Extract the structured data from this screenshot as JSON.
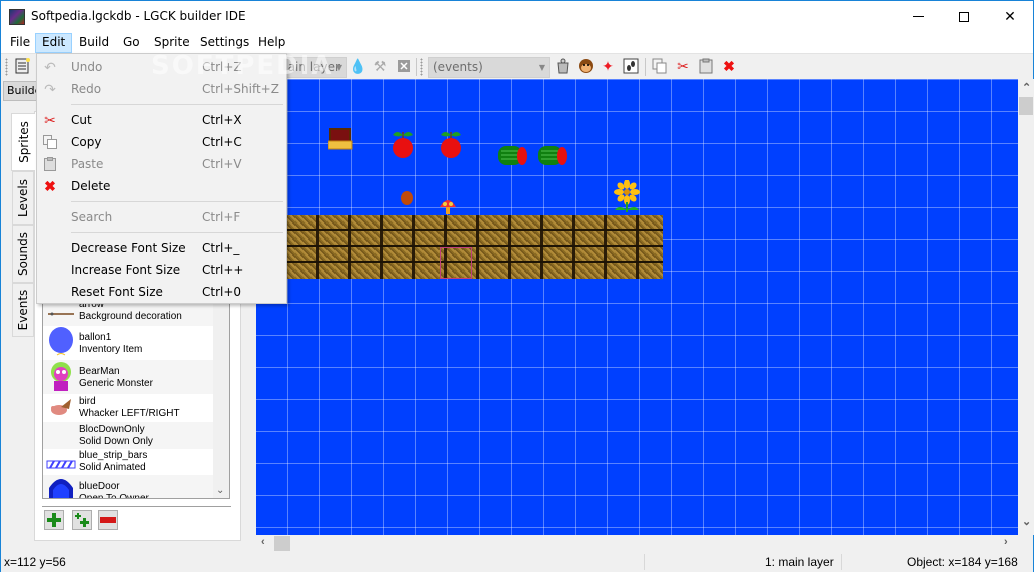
{
  "window": {
    "title": "Softpedia.lgckdb - LGCK builder IDE",
    "controls": {
      "minimize": "minimize",
      "maximize": "maximize",
      "close": "close"
    }
  },
  "menubar": {
    "items": [
      {
        "label": "File"
      },
      {
        "label": "Edit",
        "active": true
      },
      {
        "label": "Build"
      },
      {
        "label": "Go"
      },
      {
        "label": "Sprite"
      },
      {
        "label": "Settings"
      },
      {
        "label": "Help"
      }
    ]
  },
  "toolbar": {
    "layer_combo": "main layer",
    "events_combo": "(events)",
    "icons": [
      "new-file-icon",
      "water-drop-icon",
      "tool-icon",
      "close-box-icon",
      "bucket-icon",
      "monkey-icon",
      "star-icon",
      "footprints-icon",
      "copy-icon",
      "cut-icon",
      "paste-icon",
      "delete-icon"
    ]
  },
  "edit_menu": {
    "items": [
      {
        "icon": "undo-icon",
        "label": "Undo",
        "shortcut": "Ctrl+Z",
        "enabled": false
      },
      {
        "icon": "redo-icon",
        "label": "Redo",
        "shortcut": "Ctrl+Shift+Z",
        "enabled": false
      },
      {
        "icon": "cut-icon",
        "label": "Cut",
        "shortcut": "Ctrl+X",
        "enabled": true
      },
      {
        "icon": "copy-icon",
        "label": "Copy",
        "shortcut": "Ctrl+C",
        "enabled": true
      },
      {
        "icon": "paste-icon",
        "label": "Paste",
        "shortcut": "Ctrl+V",
        "enabled": false
      },
      {
        "icon": "delete-icon",
        "label": "Delete",
        "shortcut": "",
        "enabled": true
      },
      {
        "icon": "",
        "label": "Search",
        "shortcut": "Ctrl+F",
        "enabled": false
      },
      {
        "icon": "",
        "label": "Decrease Font Size",
        "shortcut": "Ctrl+_",
        "enabled": true
      },
      {
        "icon": "",
        "label": "Increase Font Size",
        "shortcut": "Ctrl++",
        "enabled": true
      },
      {
        "icon": "",
        "label": "Reset Font Size",
        "shortcut": "Ctrl+0",
        "enabled": true
      }
    ]
  },
  "dock": {
    "title": "Builder",
    "tabs": [
      {
        "label": "Sprites",
        "active": true
      },
      {
        "label": "Levels"
      },
      {
        "label": "Sounds"
      },
      {
        "label": "Events"
      }
    ],
    "sprites": [
      {
        "name": "arrow",
        "type": "Background decoration"
      },
      {
        "name": "ballon1",
        "type": "Inventory Item"
      },
      {
        "name": "BearMan",
        "type": "Generic Monster"
      },
      {
        "name": "bird",
        "type": "Whacker LEFT/RIGHT"
      },
      {
        "name": "BlocDownOnly",
        "type": "Solid Down Only"
      },
      {
        "name": "blue_strip_bars",
        "type": "Solid Animated"
      },
      {
        "name": "blueDoor",
        "type": "Open To Owner"
      }
    ],
    "buttons": {
      "add": "add-sprite",
      "add_multiple": "add-multiple-sprites",
      "remove": "remove-sprite"
    }
  },
  "colors": {
    "canvas_bg": "#0040ff",
    "menu_active": "#cce8ff",
    "accent_border": "#1883d7"
  },
  "statusbar": {
    "cursor": "x=112 y=56",
    "layer": "1: main layer",
    "object": "Object: x=184 y=168"
  },
  "watermark": "SOFTPEDIA"
}
